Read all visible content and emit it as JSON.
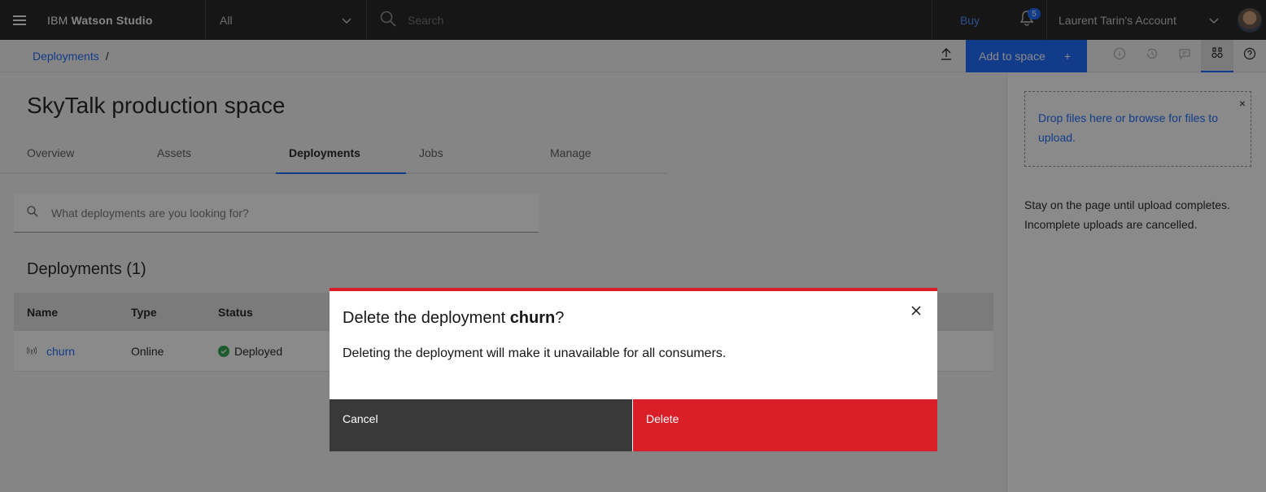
{
  "header": {
    "brand_prefix": "IBM",
    "brand_name": "Watson Studio",
    "scope_value": "All",
    "search_placeholder": "Search",
    "buy_label": "Buy",
    "notifications_count": "5",
    "account_name": "Laurent Tarin's Account"
  },
  "subheader": {
    "breadcrumb_link": "Deployments",
    "breadcrumb_sep": "/",
    "add_to_space_label": "Add to space",
    "add_icon": "+"
  },
  "main": {
    "title": "SkyTalk production space",
    "tabs": [
      {
        "label": "Overview"
      },
      {
        "label": "Assets"
      },
      {
        "label": "Deployments"
      },
      {
        "label": "Jobs"
      },
      {
        "label": "Manage"
      }
    ],
    "active_tab": "Deployments",
    "search_placeholder": "What deployments are you looking for?",
    "section_title": "Deployments (1)",
    "table": {
      "headers": [
        "Name",
        "Type",
        "Status"
      ],
      "rows": [
        {
          "name": "churn",
          "type": "Online",
          "status": "Deployed"
        }
      ]
    }
  },
  "side_panel": {
    "dropzone_text": "Drop files here or browse for files to upload.",
    "dropzone_close": "×",
    "note": "Stay on the page until upload completes. Incomplete uploads are cancelled."
  },
  "modal": {
    "title_prefix": "Delete the deployment ",
    "title_name": "churn",
    "title_suffix": "?",
    "body": "Deleting the deployment will make it unavailable for all consumers.",
    "cancel_label": "Cancel",
    "delete_label": "Delete"
  },
  "colors": {
    "topbar": "#161616",
    "primary": "#0f62fe",
    "danger": "#da1e28",
    "success": "#24a148"
  }
}
